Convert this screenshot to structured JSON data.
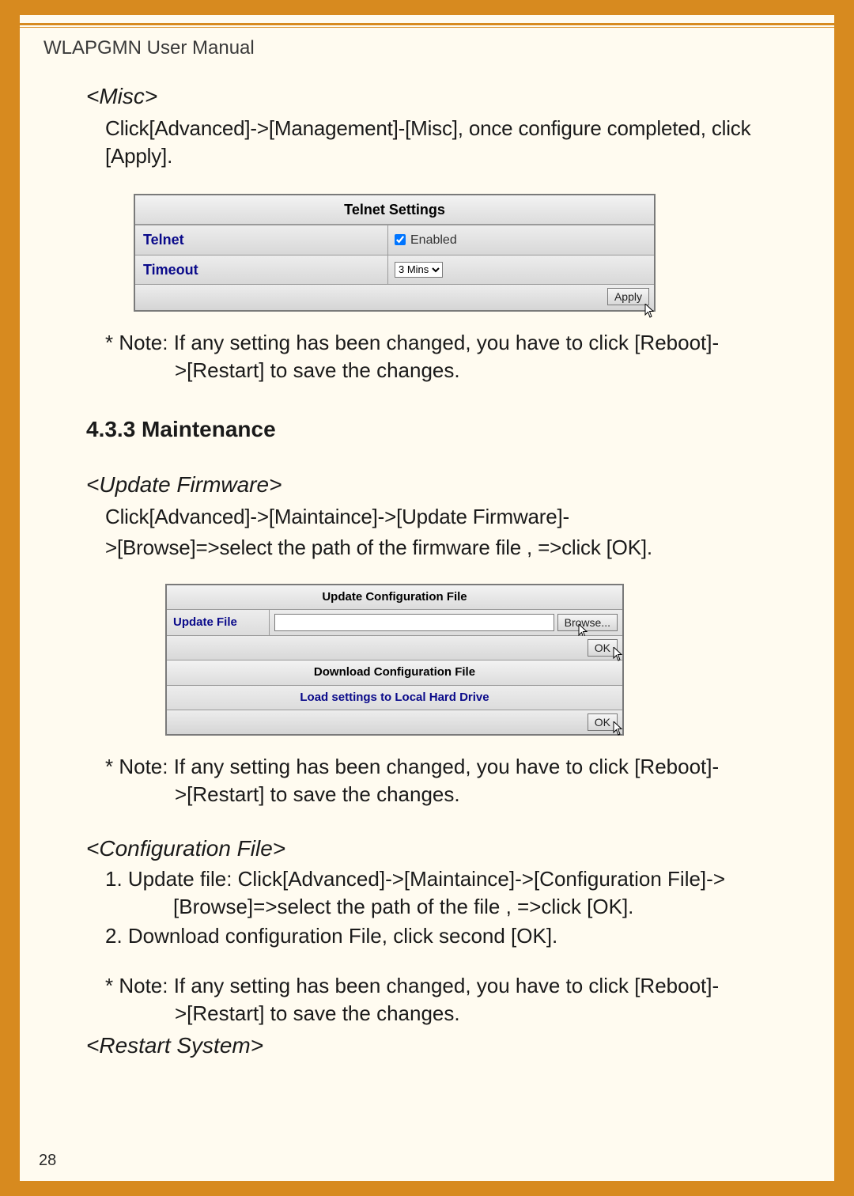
{
  "header": "WLAPGMN User Manual",
  "misc": {
    "heading": "<Misc>",
    "body": "Click[Advanced]->[Management]-[Misc], once configure completed, click [Apply].",
    "note_l1": "* Note: If any setting has been changed, you have to click [Reboot]-",
    "note_l2": ">[Restart] to save the changes."
  },
  "telnet": {
    "title": "Telnet Settings",
    "row1_label": "Telnet",
    "row1_checkbox_label": "Enabled",
    "row1_checked": true,
    "row2_label": "Timeout",
    "row2_value": "3 Mins",
    "apply": "Apply"
  },
  "maint": {
    "heading": "4.3.3 Maintenance"
  },
  "fw": {
    "heading": "<Update Firmware>",
    "body_l1": "Click[Advanced]->[Maintaince]->[Update Firmware]-",
    "body_l2": ">[Browse]=>select the path of the firmware file , =>click [OK].",
    "note_l1": "* Note: If any setting has been changed, you have to click [Reboot]-",
    "note_l2": ">[Restart] to save the changes."
  },
  "cfgpanel": {
    "title1": "Update Configuration File",
    "update_label": "Update File",
    "browse": "Browse...",
    "ok": "OK",
    "title2": "Download Configuration File",
    "link": "Load settings to Local Hard Drive"
  },
  "cfgfile": {
    "heading": "<Configuration File>",
    "li1": "1. Update file: Click[Advanced]->[Maintaince]->[Configuration File]->[Browse]=>select the path of the file , =>click [OK].",
    "li2": "2. Download configuration File, click second [OK].",
    "note_l1": "* Note: If any setting has been changed, you have to click [Reboot]-",
    "note_l2": ">[Restart] to save the changes."
  },
  "restart": {
    "heading": "<Restart System>"
  },
  "page_number": "28"
}
